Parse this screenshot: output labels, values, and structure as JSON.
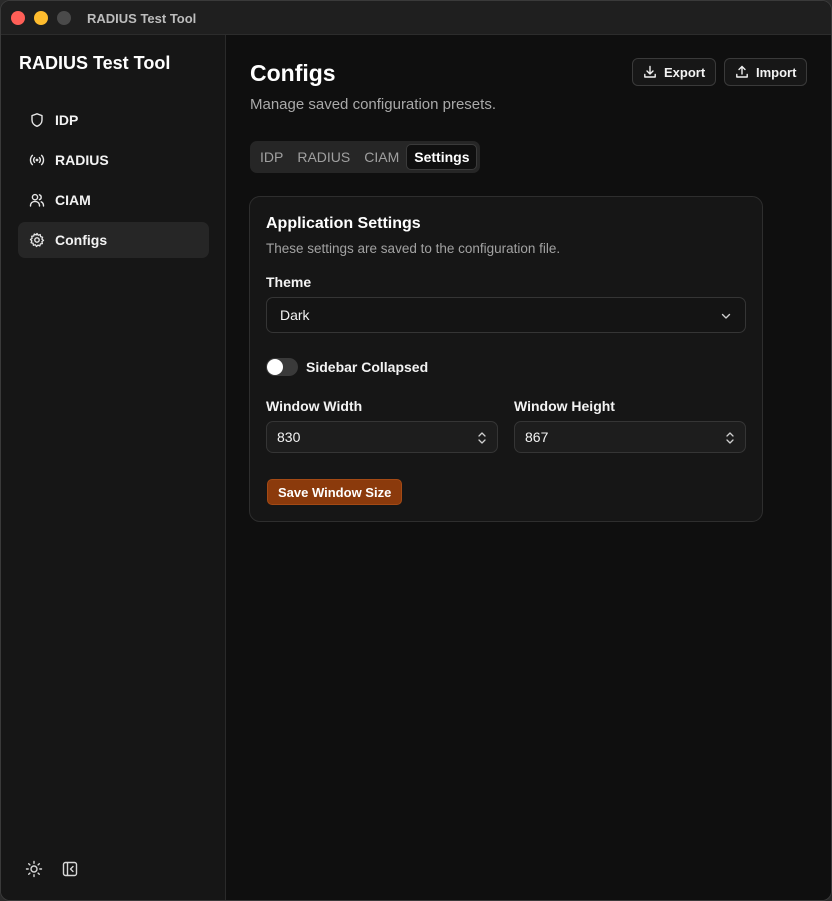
{
  "window": {
    "title": "RADIUS Test Tool"
  },
  "sidebar": {
    "app_name": "RADIUS Test Tool",
    "items": [
      {
        "label": "IDP",
        "icon": "shield-icon"
      },
      {
        "label": "RADIUS",
        "icon": "broadcast-icon"
      },
      {
        "label": "CIAM",
        "icon": "users-icon"
      },
      {
        "label": "Configs",
        "icon": "gear-icon",
        "active": true
      }
    ],
    "bottom_icons": [
      "sun-icon",
      "collapse-sidebar-icon"
    ]
  },
  "header": {
    "title": "Configs",
    "subtitle": "Manage saved configuration presets.",
    "export_label": "Export",
    "import_label": "Import"
  },
  "tabs": [
    {
      "label": "IDP"
    },
    {
      "label": "RADIUS"
    },
    {
      "label": "CIAM"
    },
    {
      "label": "Settings",
      "active": true
    }
  ],
  "settings_card": {
    "title": "Application Settings",
    "description": "These settings are saved to the configuration file.",
    "theme_label": "Theme",
    "theme_value": "Dark",
    "sidebar_collapsed_label": "Sidebar Collapsed",
    "sidebar_collapsed": false,
    "width_label": "Window Width",
    "width_value": "830",
    "height_label": "Window Height",
    "height_value": "867",
    "save_label": "Save Window Size"
  },
  "colors": {
    "accent": "#8b3a0c",
    "background": "#0f0f0f",
    "sidebar": "#161616"
  }
}
